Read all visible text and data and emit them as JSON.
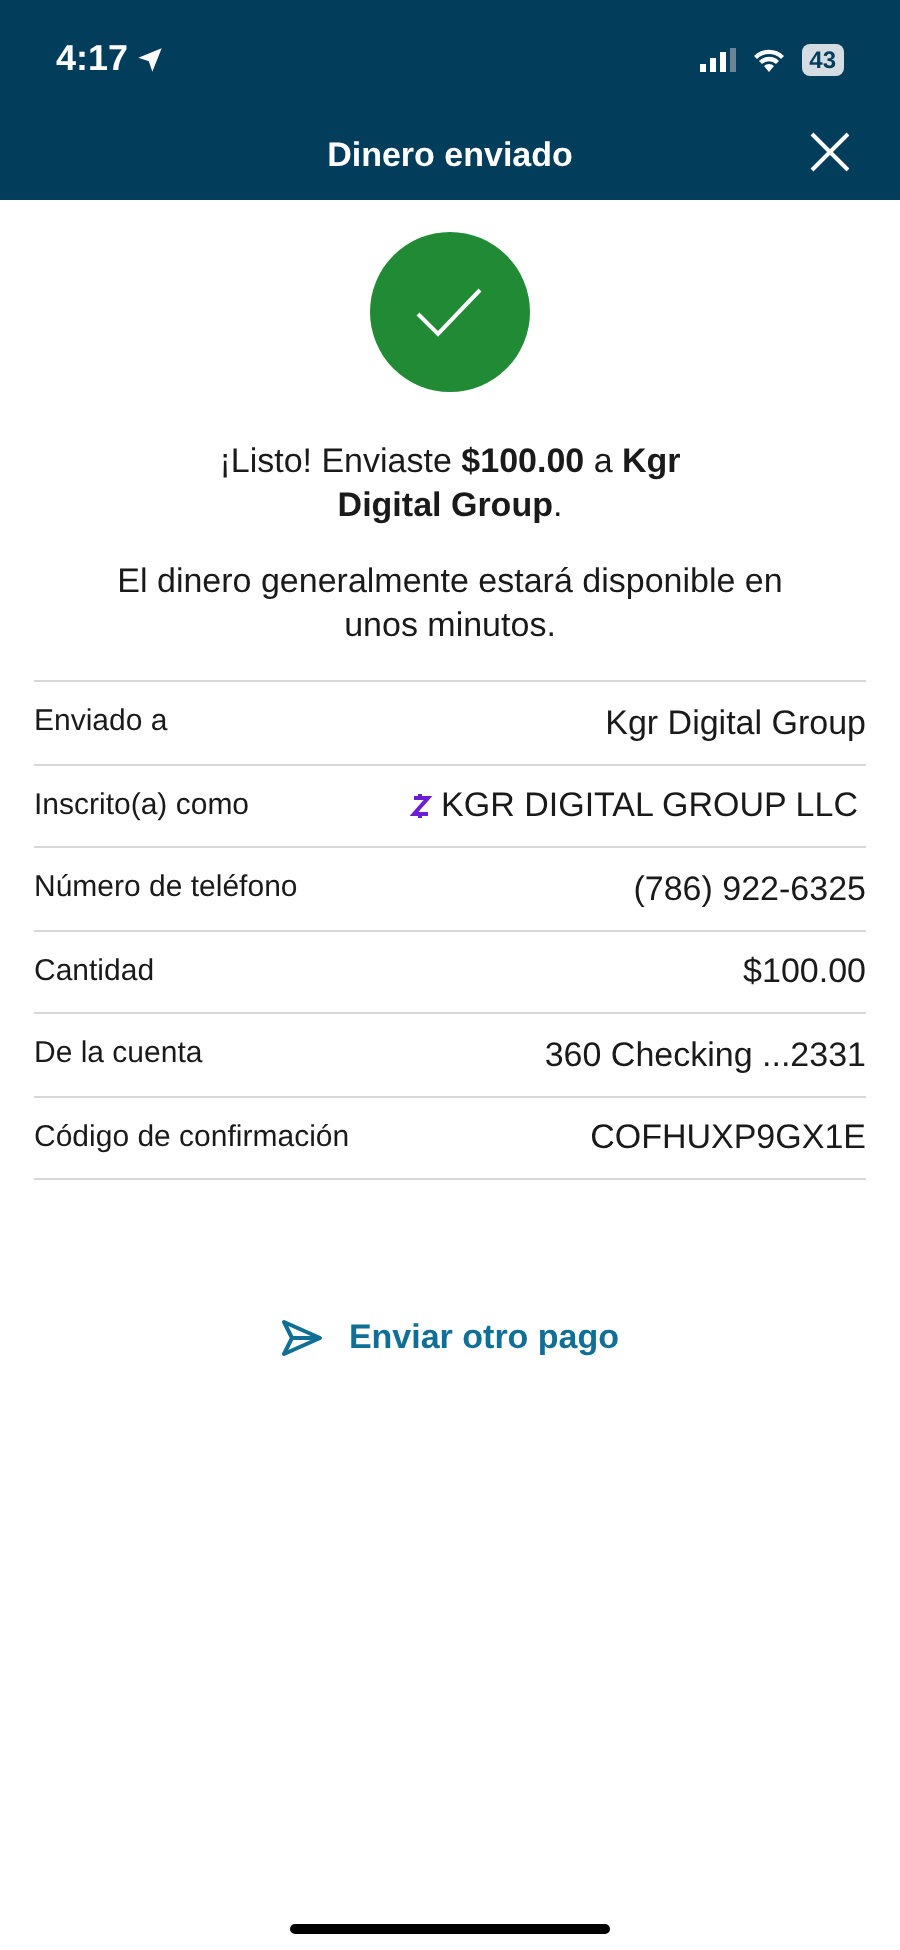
{
  "status_bar": {
    "time": "4:17",
    "battery": "43"
  },
  "header": {
    "title": "Dinero enviado"
  },
  "message": "¡Listo! Enviaste **$100.00** a **Kgr Digital Group**.",
  "note": "El dinero generalmente estará disponible en unos minutos.",
  "details": [
    {
      "kind": "plain",
      "label": "Enviado a",
      "value": "Kgr Digital Group"
    },
    {
      "kind": "zelle",
      "label": "Inscrito(a) como",
      "value": "KGR DIGITAL GROUP LLC"
    },
    {
      "kind": "plain",
      "label": "Número de teléfono",
      "value": "(786) 922-6325"
    },
    {
      "kind": "plain",
      "label": "Cantidad",
      "value": "$100.00"
    },
    {
      "kind": "plain",
      "label": "De la cuenta",
      "value": "360 Checking ...2331"
    },
    {
      "kind": "plain",
      "label": "Código de confirmación",
      "value": "COFHUXP9GX1E"
    }
  ],
  "action": "Enviar otro pago"
}
